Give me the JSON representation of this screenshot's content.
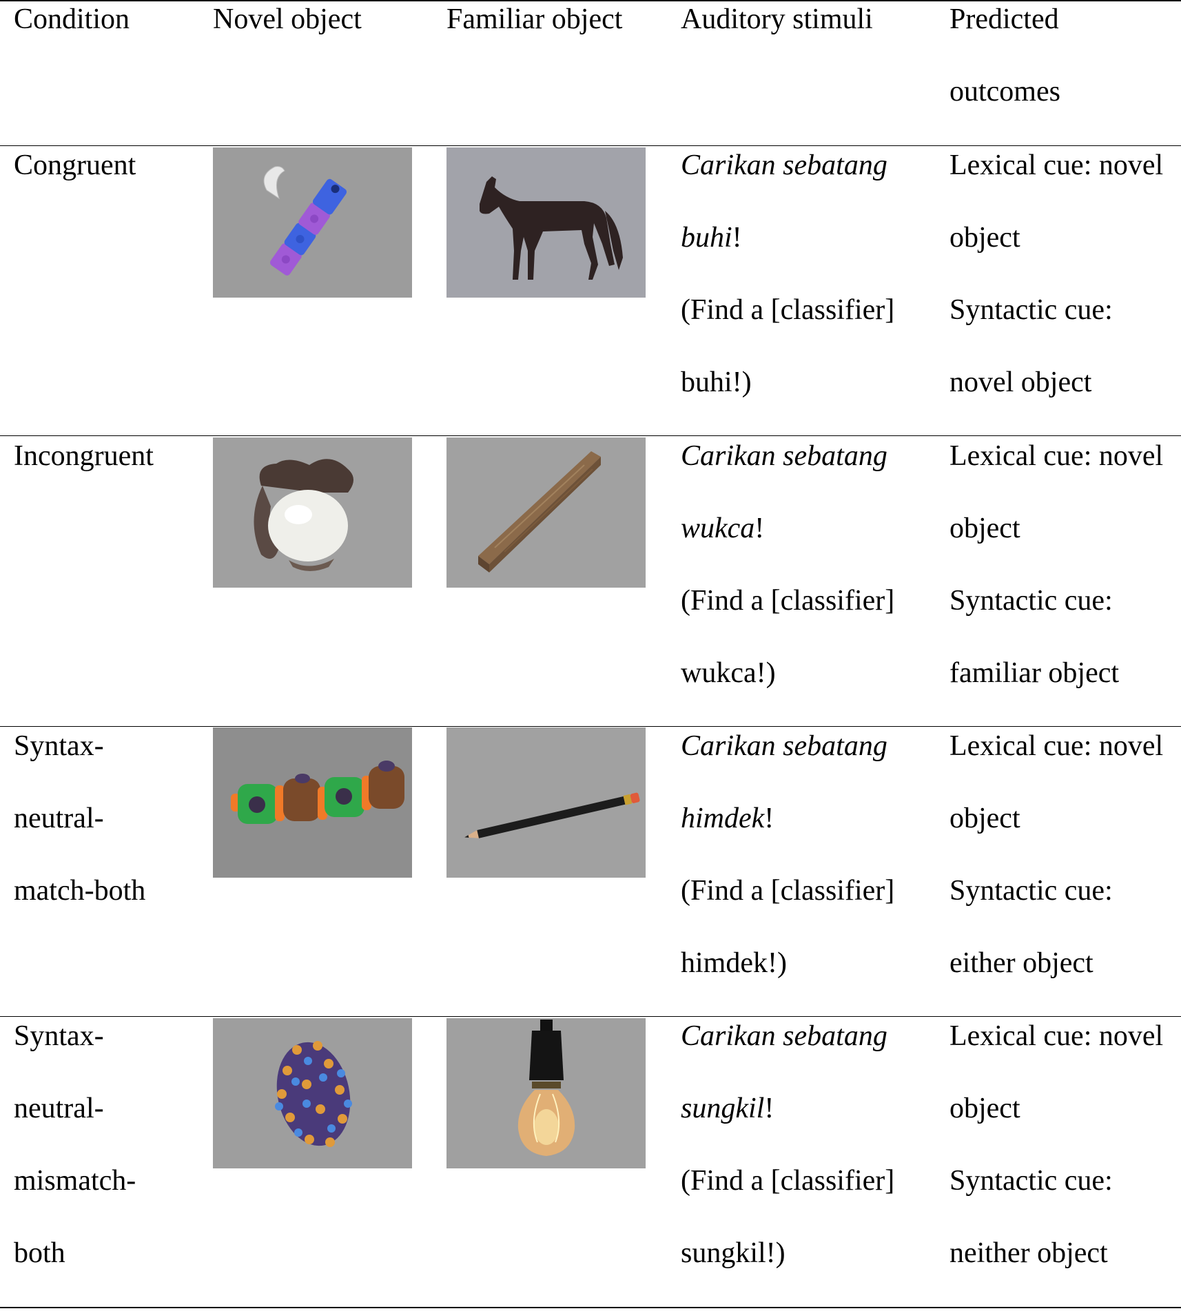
{
  "headers": {
    "condition": "Condition",
    "novel": "Novel object",
    "familiar": "Familiar object",
    "auditory": "Auditory stimuli",
    "predicted_1": "Predicted",
    "predicted_2": "outcomes"
  },
  "rows": [
    {
      "condition": [
        "Congruent"
      ],
      "novel_object_icon": "blue-purple-block-tool-icon",
      "familiar_object_icon": "horse-icon",
      "stim_phrase": "Carikan sebatang",
      "stim_word": "buhi",
      "stim_translation_1": "(Find a [classifier]",
      "stim_translation_2": "buhi!)",
      "outcome": [
        "Lexical cue: novel",
        "object",
        "Syntactic cue:",
        "novel object"
      ]
    },
    {
      "condition": [
        "Incongruent"
      ],
      "novel_object_icon": "white-bulb-rootlike-object-icon",
      "familiar_object_icon": "wooden-plank-icon",
      "stim_phrase": "Carikan sebatang",
      "stim_word": "wukca",
      "stim_translation_1": "(Find a [classifier]",
      "stim_translation_2": "wukca!)",
      "outcome": [
        "Lexical cue: novel",
        "object",
        "Syntactic cue:",
        "familiar object"
      ]
    },
    {
      "condition": [
        "Syntax-",
        "neutral-",
        "match-both"
      ],
      "novel_object_icon": "green-brown-bead-chain-icon",
      "familiar_object_icon": "pencil-icon",
      "stim_phrase": "Carikan sebatang",
      "stim_word": "himdek",
      "stim_translation_1": "(Find a [classifier]",
      "stim_translation_2": "himdek!)",
      "outcome": [
        "Lexical cue: novel",
        "object",
        "Syntactic cue:",
        "either object"
      ]
    },
    {
      "condition": [
        "Syntax-",
        "neutral-",
        "mismatch-",
        "both"
      ],
      "novel_object_icon": "purple-spiky-egg-icon",
      "familiar_object_icon": "light-bulb-icon",
      "stim_phrase": "Carikan sebatang",
      "stim_word": "sungkil",
      "stim_translation_1": "(Find a [classifier]",
      "stim_translation_2": "sungkil!)",
      "outcome": [
        "Lexical cue: novel",
        "object",
        "Syntactic cue:",
        "neither object"
      ]
    }
  ]
}
